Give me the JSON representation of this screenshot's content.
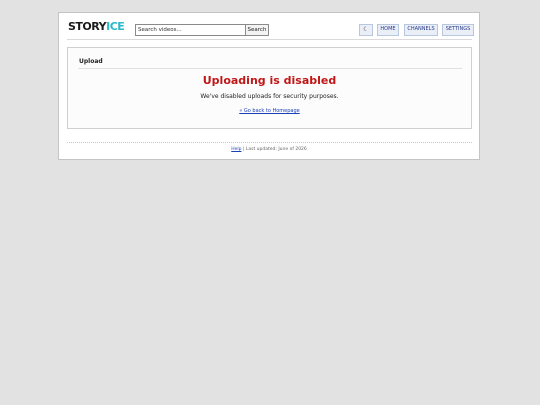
{
  "header": {
    "logo_primary": "STORY",
    "logo_accent": "ICE",
    "search_placeholder": "Search videos...",
    "search_button": "Search",
    "theme_icon": "☾",
    "nav": {
      "home": "HOME",
      "channels": "CHANNELS",
      "settings": "SETTINGS"
    }
  },
  "panel": {
    "title": "Upload",
    "error_title": "Uploading is disabled",
    "error_message": "We've disabled uploads for security purposes.",
    "back_link": "« Go back to Homepage"
  },
  "footer": {
    "help_link": "Help",
    "separator": "|",
    "last_updated": "Last updated: June of 2026"
  },
  "colors": {
    "background": "#e2e2e2",
    "logo_accent": "#2bb8c9",
    "error": "#c01616",
    "link": "#1a3fb8"
  },
  "icons": {
    "theme": "moon-icon"
  }
}
